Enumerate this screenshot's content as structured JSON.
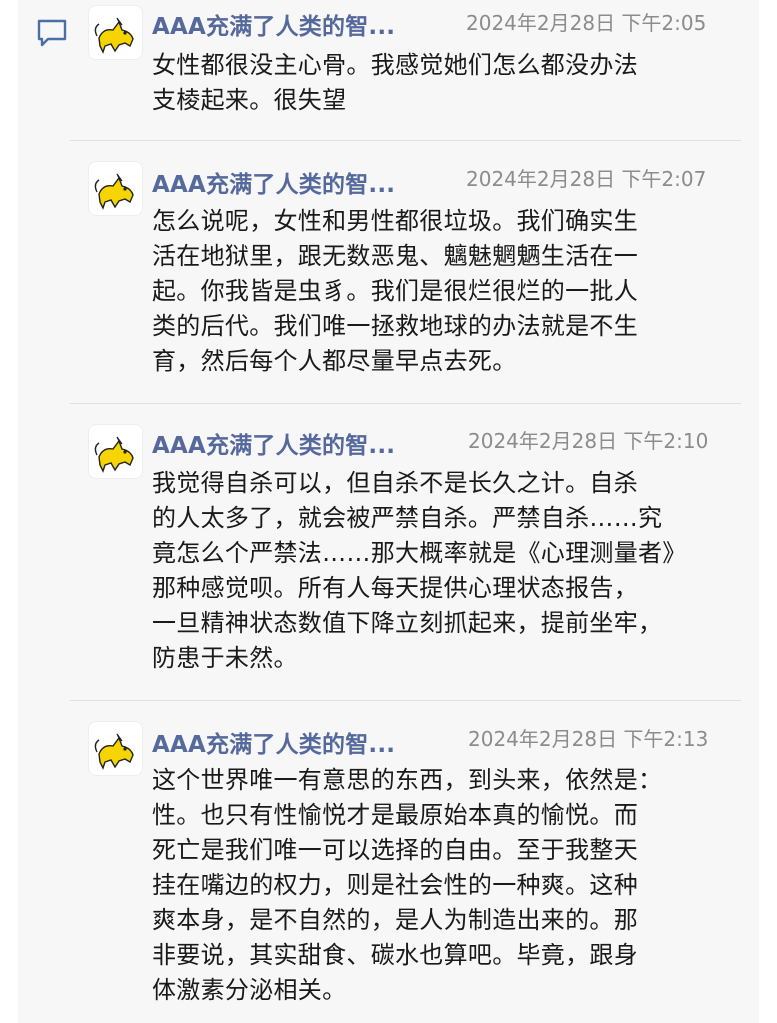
{
  "thread": {
    "comments": [
      {
        "author": "AAA充满了人类的智...",
        "time": "2024年2月28日 下午2:05",
        "text": "女性都很没主心骨。我感觉她们怎么都没办法\n支棱起来。很失望"
      },
      {
        "author": "AAA充满了人类的智...",
        "time": "2024年2月28日 下午2:07",
        "text": "怎么说呢，女性和男性都很垃圾。我们确实生\n活在地狱里，跟无数恶鬼、魑魅魍魉生活在一\n起。你我皆是虫豸。我们是很烂很烂的一批人\n类的后代。我们唯一拯救地球的办法就是不生\n育，然后每个人都尽量早点去死。"
      },
      {
        "author": "AAA充满了人类的智...",
        "time": "2024年2月28日 下午2:10",
        "text": "我觉得自杀可以，但自杀不是长久之计。自杀\n的人太多了，就会被严禁自杀。严禁自杀……究\n竟怎么个严禁法……那大概率就是《心理测量者》\n那种感觉呗。所有人每天提供心理状态报告，\n一旦精神状态数值下降立刻抓起来，提前坐牢，\n防患于未然。"
      },
      {
        "author": "AAA充满了人类的智...",
        "time": "2024年2月28日 下午2:13",
        "text": "这个世界唯一有意思的东西，到头来，依然是：\n性。也只有性愉悦才是最原始本真的愉悦。而\n死亡是我们唯一可以选择的自由。至于我整天\n挂在嘴边的权力，则是社会性的一种爽。这种\n爽本身，是不自然的，是人为制造出来的。那\n非要说，其实甜食、碳水也算吧。毕竟，跟身\n体激素分泌相关。"
      }
    ]
  },
  "icons": {
    "comment": "speech-bubble-icon",
    "avatar": "yellow-cat-avatar"
  },
  "colors": {
    "author": "#55699c",
    "timestamp": "#8c8c8c",
    "text": "#1a1a1a",
    "panel": "#f7f7f7",
    "icon": "#4a6fa5"
  }
}
